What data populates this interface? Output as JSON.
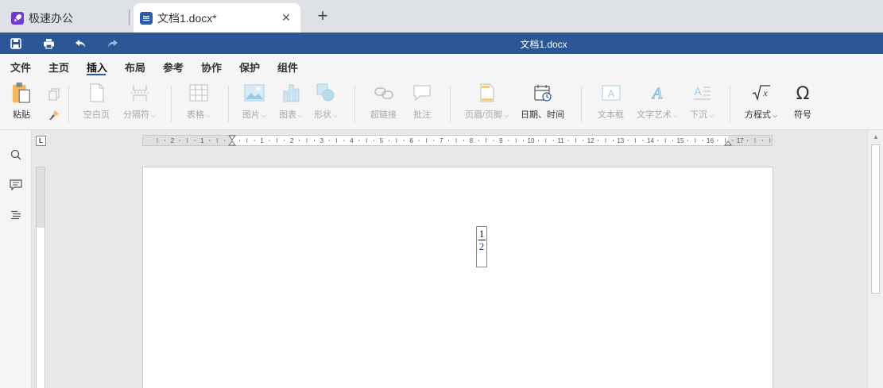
{
  "tabs": [
    {
      "label": "极速办公",
      "icon": "rocket-icon"
    },
    {
      "label": "文档1.docx*",
      "icon": "document-icon"
    }
  ],
  "new_tab": "+",
  "close_tab": "✕",
  "titlebar": {
    "title": "文档1.docx",
    "color": "#2b5797",
    "buttons": [
      "save-icon",
      "print-icon",
      "undo-icon",
      "redo-icon"
    ]
  },
  "menu": {
    "items": [
      "文件",
      "主页",
      "插入",
      "布局",
      "参考",
      "协作",
      "保护",
      "组件"
    ],
    "active": "插入"
  },
  "ribbon": {
    "paste": "粘贴",
    "blank_page": "空白页",
    "separator": "分隔符",
    "table": "表格",
    "image": "图片",
    "chart": "图表",
    "shape": "形状",
    "hyperlink": "超链接",
    "comment": "批注",
    "header_footer": "页眉/页脚",
    "datetime": "日期、时间",
    "textbox": "文本框",
    "textart": "文字艺术",
    "dropcap": "下沉",
    "equation": "方程式",
    "symbol": "符号"
  },
  "ruler": {
    "corner": "L",
    "marks": [
      "2",
      "1",
      "1",
      "2",
      "3",
      "4",
      "5",
      "6",
      "7",
      "8",
      "9",
      "10",
      "11",
      "12",
      "13",
      "14",
      "15",
      "16",
      "17"
    ]
  },
  "document": {
    "fraction_numerator": "1",
    "fraction_denominator": "2"
  }
}
